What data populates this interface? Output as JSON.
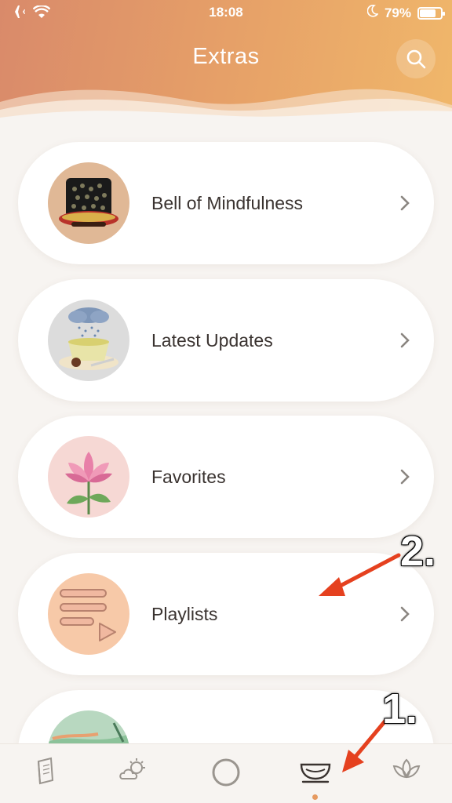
{
  "status_bar": {
    "time": "18:08",
    "battery_percent": "79%",
    "battery_level": 0.79,
    "left_icons": [
      "airplane-icon",
      "wifi-icon"
    ],
    "right_icons": [
      "moon-icon",
      "battery-icon"
    ]
  },
  "header": {
    "title": "Extras",
    "search_icon": "search-icon",
    "gradient": [
      "#d98a6a",
      "#f0b76a"
    ]
  },
  "items": [
    {
      "label": "Bell of Mindfulness",
      "icon": "bell-icon"
    },
    {
      "label": "Latest Updates",
      "icon": "tea-cup-icon"
    },
    {
      "label": "Favorites",
      "icon": "lotus-flower-icon"
    },
    {
      "label": "Playlists",
      "icon": "playlist-icon"
    },
    {
      "label": "",
      "icon": "landscape-icon"
    }
  ],
  "tabbar": {
    "tabs": [
      {
        "name": "book-icon"
      },
      {
        "name": "weather-icon"
      },
      {
        "name": "circle-icon"
      },
      {
        "name": "tea-bowl-icon",
        "active": true
      },
      {
        "name": "lotus-icon"
      }
    ],
    "active_color": "#e69a60"
  },
  "annotations": [
    "1.",
    "2."
  ],
  "colors": {
    "background": "#f7f4f1",
    "card": "#ffffff",
    "text": "#3a3330",
    "annotation_arrow": "#e5411f"
  }
}
